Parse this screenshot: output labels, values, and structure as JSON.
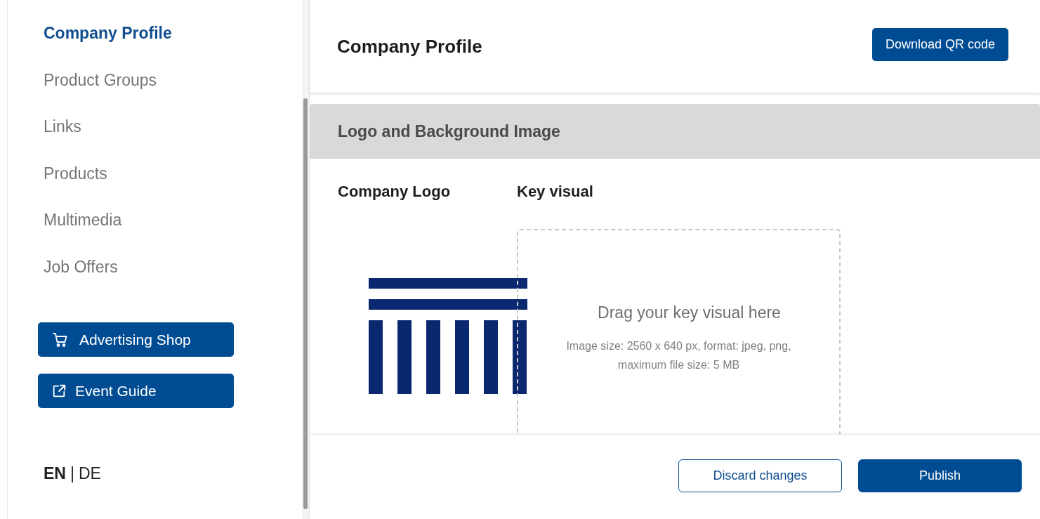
{
  "sidebar": {
    "items": [
      {
        "label": "Company Profile",
        "selected": true
      },
      {
        "label": "Product Groups",
        "selected": false
      },
      {
        "label": "Links",
        "selected": false
      },
      {
        "label": "Products",
        "selected": false
      },
      {
        "label": "Multimedia",
        "selected": false
      },
      {
        "label": "Job Offers",
        "selected": false
      }
    ],
    "buttons": [
      {
        "label": "Advertising Shop",
        "kind": "cart"
      },
      {
        "label": "Event Guide",
        "kind": "external"
      }
    ],
    "languages": [
      {
        "label": "EN",
        "selected": true
      },
      {
        "label": "DE",
        "selected": false
      }
    ],
    "language_separator": "|"
  },
  "header": {
    "title": "Company Profile",
    "button": "Download QR code"
  },
  "section": {
    "title": "Logo and Background Image",
    "logo_label": "Company Logo",
    "key_visual_label": "Key visual",
    "dropzone": {
      "title": "Drag your key visual here",
      "hint": "Image size: 2560 x 640 px, format: jpeg, png, maximum file size: 5 MB"
    }
  },
  "footer": {
    "discard": "Discard changes",
    "publish": "Publish"
  }
}
